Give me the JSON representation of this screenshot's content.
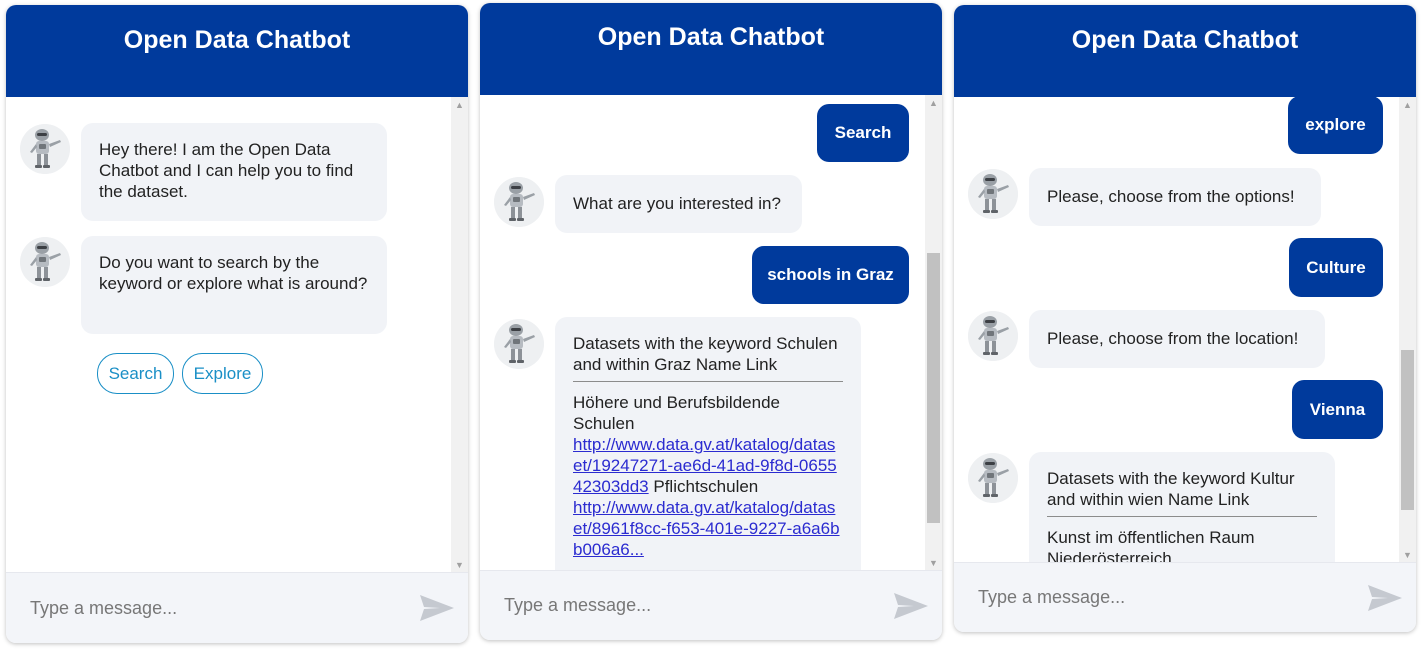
{
  "app": {
    "title": "Open Data Chatbot"
  },
  "footer": {
    "placeholder": "Type a message..."
  },
  "panel1": {
    "bot_greeting": "Hey there! I am the Open Data Chatbot and I can help you to find the dataset.",
    "bot_question": "Do you want to search by the keyword or explore what is around?",
    "quick_replies": [
      "Search",
      "Explore"
    ]
  },
  "panel2": {
    "user_search": "Search",
    "bot_interest": "What are you interested in?",
    "user_query": "schools in Graz",
    "result_header": "Datasets with the keyword Schulen and within Graz Name Link",
    "result_item1_name": "Höhere und Berufsbildende Schulen",
    "result_item1_link": "http://www.data.gv.at/katalog/dataset/19247271-ae6d-41ad-9f8d-065542303dd3",
    "result_item2_name": "Pflichtschulen",
    "result_item2_link": "http://www.data.gv.at/katalog/dataset/8961f8cc-f653-401e-9227-",
    "result_item2_link_cut": "a6a6bb006a6..."
  },
  "panel3": {
    "user_explore": "explore",
    "bot_options": "Please, choose from the options!",
    "user_culture": "Culture",
    "bot_location": "Please, choose from the location!",
    "user_vienna": "Vienna",
    "result_header": "Datasets with the keyword Kultur and within wien Name Link",
    "result_item1_name": "Kunst im öffentlichen Raum Niederösterreich"
  },
  "colors": {
    "header": "#003a9c",
    "user_bubble": "#003a9c",
    "bot_bubble": "#f1f3f7",
    "accent": "#1a8fc6",
    "link": "#2b2bd0"
  }
}
